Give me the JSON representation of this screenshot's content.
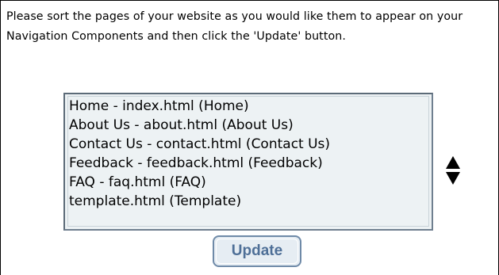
{
  "instructions": "Please sort the pages of your website as you would like them to appear on your Navigation Components and then click the 'Update' button.",
  "page_list": {
    "items": [
      "Home - index.html (Home)",
      "About Us - about.html (About Us)",
      "Contact Us - contact.html (Contact Us)",
      "Feedback - feedback.html (Feedback)",
      "FAQ - faq.html (FAQ)",
      "template.html (Template)"
    ]
  },
  "move_controls": {
    "up_icon": "triangle-up-icon",
    "down_icon": "triangle-down-icon"
  },
  "update_button": {
    "label": "Update"
  },
  "colors": {
    "listbox_background": "#edf2f4",
    "button_text": "#4e6f97",
    "button_border": "#6f8aa8",
    "button_background": "#e6edf3"
  }
}
